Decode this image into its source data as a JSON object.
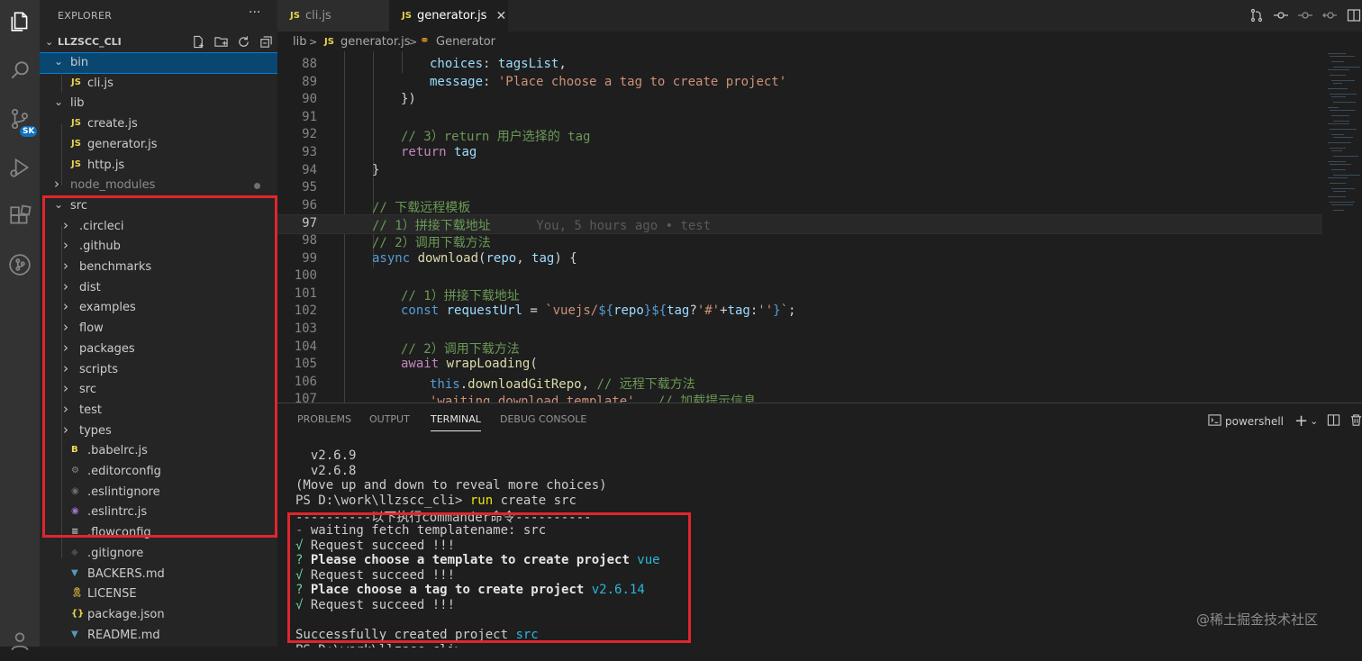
{
  "explorer": {
    "title": "EXPLORER",
    "more": "···",
    "workspace": "LLZSCC_CLI",
    "tree": [
      {
        "label": "bin",
        "type": "folder",
        "open": true,
        "indent": 0,
        "selected": true
      },
      {
        "label": "cli.js",
        "type": "js",
        "indent": 1
      },
      {
        "label": "lib",
        "type": "folder",
        "open": true,
        "indent": 0
      },
      {
        "label": "create.js",
        "type": "js",
        "indent": 1
      },
      {
        "label": "generator.js",
        "type": "js",
        "indent": 1
      },
      {
        "label": "http.js",
        "type": "js",
        "indent": 1
      },
      {
        "label": "node_modules",
        "type": "folder",
        "open": false,
        "indent": 0,
        "dimmed": true
      },
      {
        "label": "src",
        "type": "folder",
        "open": true,
        "indent": 0
      },
      {
        "label": ".circleci",
        "type": "folder",
        "open": false,
        "indent": 1
      },
      {
        "label": ".github",
        "type": "folder",
        "open": false,
        "indent": 1
      },
      {
        "label": "benchmarks",
        "type": "folder",
        "open": false,
        "indent": 1
      },
      {
        "label": "dist",
        "type": "folder",
        "open": false,
        "indent": 1
      },
      {
        "label": "examples",
        "type": "folder",
        "open": false,
        "indent": 1
      },
      {
        "label": "flow",
        "type": "folder",
        "open": false,
        "indent": 1
      },
      {
        "label": "packages",
        "type": "folder",
        "open": false,
        "indent": 1
      },
      {
        "label": "scripts",
        "type": "folder",
        "open": false,
        "indent": 1
      },
      {
        "label": "src",
        "type": "folder",
        "open": false,
        "indent": 1
      },
      {
        "label": "test",
        "type": "folder",
        "open": false,
        "indent": 1
      },
      {
        "label": "types",
        "type": "folder",
        "open": false,
        "indent": 1
      },
      {
        "label": ".babelrc.js",
        "type": "babel",
        "indent": 1
      },
      {
        "label": ".editorconfig",
        "type": "gear",
        "indent": 1
      },
      {
        "label": ".eslintignore",
        "type": "circle",
        "indent": 1
      },
      {
        "label": ".eslintrc.js",
        "type": "eslint",
        "indent": 1
      },
      {
        "label": ".flowconfig",
        "type": "lines",
        "indent": 1
      },
      {
        "label": ".gitignore",
        "type": "git",
        "indent": 1
      },
      {
        "label": "BACKERS.md",
        "type": "md",
        "indent": 1
      },
      {
        "label": "LICENSE",
        "type": "license",
        "indent": 1
      },
      {
        "label": "package.json",
        "type": "json",
        "indent": 1
      },
      {
        "label": "README.md",
        "type": "md",
        "indent": 1
      }
    ]
  },
  "activity_badge": "SK",
  "tabs": [
    {
      "label": "cli.js",
      "active": false
    },
    {
      "label": "generator.js",
      "active": true,
      "close": "✕"
    }
  ],
  "breadcrumb": {
    "folder": "lib",
    "file": "generator.js",
    "symbol": "Generator",
    "sep": ">"
  },
  "code": {
    "current_line": 97,
    "blame": "You, 5 hours ago • test",
    "lines": [
      {
        "n": 88,
        "indent": 3,
        "parts": [
          [
            "var",
            "choices"
          ],
          [
            "pl",
            ": "
          ],
          [
            "var",
            "tagsList"
          ],
          [
            "pl",
            ","
          ]
        ]
      },
      {
        "n": 89,
        "indent": 3,
        "parts": [
          [
            "var",
            "message"
          ],
          [
            "pl",
            ": "
          ],
          [
            "str",
            "'Place choose a tag to create project'"
          ]
        ]
      },
      {
        "n": 90,
        "indent": 2,
        "parts": [
          [
            "pl",
            "})"
          ]
        ]
      },
      {
        "n": 91,
        "indent": 0,
        "parts": []
      },
      {
        "n": 92,
        "indent": 2,
        "parts": [
          [
            "cm",
            "// 3）return 用户选择的 tag"
          ]
        ]
      },
      {
        "n": 93,
        "indent": 2,
        "parts": [
          [
            "kw2",
            "return"
          ],
          [
            "pl",
            " "
          ],
          [
            "var",
            "tag"
          ]
        ]
      },
      {
        "n": 94,
        "indent": 1,
        "parts": [
          [
            "pl",
            "}"
          ]
        ]
      },
      {
        "n": 95,
        "indent": 0,
        "parts": []
      },
      {
        "n": 96,
        "indent": 1,
        "parts": [
          [
            "cm",
            "// 下载远程模板"
          ]
        ]
      },
      {
        "n": 97,
        "indent": 1,
        "parts": [
          [
            "cm",
            "// 1）拼接下载地址"
          ]
        ]
      },
      {
        "n": 98,
        "indent": 1,
        "parts": [
          [
            "cm",
            "// 2）调用下载方法"
          ]
        ]
      },
      {
        "n": 99,
        "indent": 1,
        "parts": [
          [
            "kw",
            "async"
          ],
          [
            "pl",
            " "
          ],
          [
            "fn",
            "download"
          ],
          [
            "pl",
            "("
          ],
          [
            "var",
            "repo"
          ],
          [
            "pl",
            ", "
          ],
          [
            "var",
            "tag"
          ],
          [
            "pl",
            ") {"
          ]
        ]
      },
      {
        "n": 100,
        "indent": 0,
        "parts": []
      },
      {
        "n": 101,
        "indent": 2,
        "parts": [
          [
            "cm",
            "// 1）拼接下载地址"
          ]
        ]
      },
      {
        "n": 102,
        "indent": 2,
        "parts": [
          [
            "kw",
            "const"
          ],
          [
            "pl",
            " "
          ],
          [
            "var",
            "requestUrl"
          ],
          [
            "pl",
            " = "
          ],
          [
            "str",
            "`vuejs/"
          ],
          [
            "kw",
            "${"
          ],
          [
            "var",
            "repo"
          ],
          [
            "kw",
            "}${"
          ],
          [
            "var",
            "tag"
          ],
          [
            "pl",
            "?"
          ],
          [
            "str",
            "'#'"
          ],
          [
            "pl",
            "+"
          ],
          [
            "var",
            "tag"
          ],
          [
            "pl",
            ":"
          ],
          [
            "str",
            "''"
          ],
          [
            "kw",
            "}"
          ],
          [
            "str",
            "`"
          ],
          [
            "pl",
            ";"
          ]
        ]
      },
      {
        "n": 103,
        "indent": 0,
        "parts": []
      },
      {
        "n": 104,
        "indent": 2,
        "parts": [
          [
            "cm",
            "// 2）调用下载方法"
          ]
        ]
      },
      {
        "n": 105,
        "indent": 2,
        "parts": [
          [
            "kw2",
            "await"
          ],
          [
            "pl",
            " "
          ],
          [
            "fn",
            "wrapLoading"
          ],
          [
            "pl",
            "("
          ]
        ]
      },
      {
        "n": 106,
        "indent": 3,
        "parts": [
          [
            "kw",
            "this"
          ],
          [
            "pl",
            "."
          ],
          [
            "fn",
            "downloadGitRepo"
          ],
          [
            "pl",
            ", "
          ],
          [
            "cm",
            "// 远程下载方法"
          ]
        ]
      },
      {
        "n": 107,
        "indent": 3,
        "parts": [
          [
            "str",
            "'waiting download template'"
          ],
          [
            "pl",
            ",  "
          ],
          [
            "cm",
            "// 加载提示信息"
          ]
        ]
      }
    ]
  },
  "panel": {
    "tabs": [
      "PROBLEMS",
      "OUTPUT",
      "TERMINAL",
      "DEBUG CONSOLE"
    ],
    "active_tab": "TERMINAL",
    "shell": "powershell",
    "add": "+",
    "terminal_lines": [
      {
        "parts": [
          [
            "",
            "  v2.6.9"
          ]
        ]
      },
      {
        "parts": [
          [
            "",
            "  v2.6.8"
          ]
        ]
      },
      {
        "parts": [
          [
            "",
            "(Move up and down to reveal more choices)"
          ]
        ]
      },
      {
        "parts": [
          [
            "",
            "PS D:\\work\\llzscc_cli> "
          ],
          [
            "tyellow",
            "run"
          ],
          [
            "",
            " create src"
          ]
        ]
      },
      {
        "parts": [
          [
            "",
            "----------以下执行commander命令----------"
          ]
        ]
      },
      {
        "parts": [
          [
            "tgray",
            "- "
          ],
          [
            "",
            "waiting fetch templatename: src"
          ]
        ]
      },
      {
        "parts": [
          [
            "tgreen",
            "√"
          ],
          [
            "",
            " Request succeed !!!"
          ]
        ]
      },
      {
        "parts": [
          [
            "tgreen",
            "?"
          ],
          [
            "tbold",
            " Please choose a template to create project"
          ],
          [
            "tcyan",
            " vue"
          ]
        ]
      },
      {
        "parts": [
          [
            "tgreen",
            "√"
          ],
          [
            "",
            " Request succeed !!!"
          ]
        ]
      },
      {
        "parts": [
          [
            "tgreen",
            "?"
          ],
          [
            "tbold",
            " Place choose a tag to create project"
          ],
          [
            "tcyan",
            " v2.6.14"
          ]
        ]
      },
      {
        "parts": [
          [
            "tgreen",
            "√"
          ],
          [
            "",
            " Request succeed !!!"
          ]
        ]
      },
      {
        "parts": [
          [
            "",
            ""
          ]
        ]
      },
      {
        "parts": [
          [
            "",
            "Successfully created project "
          ],
          [
            "tcyan",
            "src"
          ]
        ]
      },
      {
        "parts": [
          [
            "",
            "PS D:\\work\\llzscc_cli> "
          ]
        ]
      }
    ]
  },
  "watermark": "@稀土掘金技术社区",
  "colors": {
    "highlight": "#e0262d",
    "accent": "#007fd4",
    "selection": "#094771"
  }
}
